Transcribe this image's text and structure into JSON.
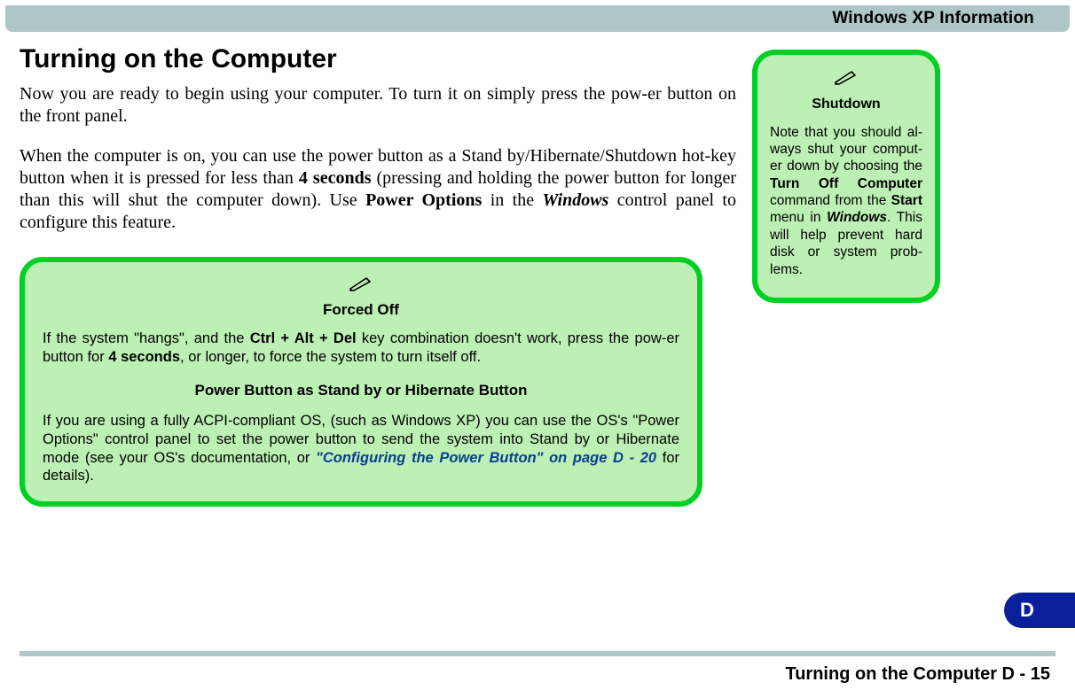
{
  "header": {
    "title": "Windows XP Information"
  },
  "heading": "Turning on the Computer",
  "para1_pre": "Now you are ready to begin using your computer. To turn it on simply press the pow",
  "para1_post": "er button on the front panel.",
  "para2_a": "When the computer is on, you can use the power button as a Stand by/Hibernate/Shutdown hot-key button when it is pressed for less than ",
  "para2_b": "4 seconds",
  "para2_c": " (pressing and holding the power button for longer than this will shut the computer down). Use ",
  "para2_d": "Power Options",
  "para2_e": " in the ",
  "para2_f": "Windows",
  "para2_g": " control panel to configure this feature.",
  "callout1": {
    "title": "Forced Off",
    "p1_a": "If the system \"hangs\", and the ",
    "p1_b": "Ctrl + Alt + Del",
    "p1_c": " key combination doesn't work, press the pow",
    "p1_d": "er button for ",
    "p1_e": "4 seconds",
    "p1_f": ", or longer, to force the system to turn itself off.",
    "sub": "Power Button as Stand by or Hibernate Button",
    "p2_a": "If you are using a fully ACPI-compliant OS, (such as Windows XP) you can use the OS's \"Power Options\" control panel to set the power button to send the system into Stand by or Hibernate mode (see your OS's documentation, or ",
    "p2_b": "\"Configuring the Power Button\" on page D - 20",
    "p2_c": " for details)."
  },
  "callout2": {
    "title": "Shutdown",
    "p_a": "Note that you should al",
    "p_b": "ways shut your comput",
    "p_c": "er down by choosing the ",
    "p_d": "Turn Off Computer",
    "p_e": " command from the ",
    "p_f": "Start",
    "p_g": " menu in ",
    "p_h": "Windows",
    "p_i": ". This will help prevent hard disk or system prob",
    "p_j": "lems."
  },
  "tab": "D",
  "footer": "Turning on the Computer  D  -  15"
}
